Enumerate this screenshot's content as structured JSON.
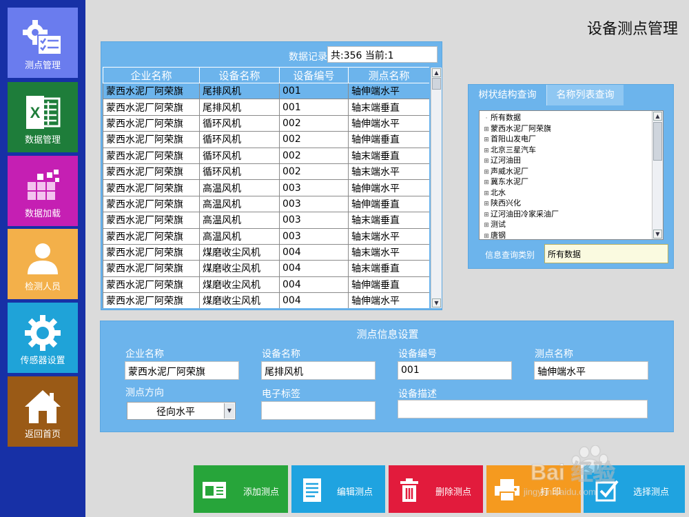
{
  "page_title": "设备测点管理",
  "sidebar": {
    "items": [
      {
        "label": "测点管理",
        "color": "#6a7cee",
        "icon": "gear-checklist-icon"
      },
      {
        "label": "数据管理",
        "color": "#1e7d3a",
        "icon": "excel-icon"
      },
      {
        "label": "数据加载",
        "color": "#c51fb3",
        "icon": "cubes-icon"
      },
      {
        "label": "检测人员",
        "color": "#f3b04a",
        "icon": "person-icon"
      },
      {
        "label": "传感器设置",
        "color": "#1fa3d8",
        "icon": "gear-icon"
      },
      {
        "label": "返回首页",
        "color": "#9a5a16",
        "icon": "home-icon"
      }
    ]
  },
  "records": {
    "label": "数据记录",
    "count": "共:356  当前:1",
    "columns": [
      "企业名称",
      "设备名称",
      "设备编号",
      "测点名称"
    ],
    "rows": [
      [
        "蒙西水泥厂阿荣旗",
        "尾排风机",
        "001",
        "轴伸端水平"
      ],
      [
        "蒙西水泥厂阿荣旗",
        "尾排风机",
        "001",
        "轴末端垂直"
      ],
      [
        "蒙西水泥厂阿荣旗",
        "循环风机",
        "002",
        "轴伸端水平"
      ],
      [
        "蒙西水泥厂阿荣旗",
        "循环风机",
        "002",
        "轴伸端垂直"
      ],
      [
        "蒙西水泥厂阿荣旗",
        "循环风机",
        "002",
        "轴末端垂直"
      ],
      [
        "蒙西水泥厂阿荣旗",
        "循环风机",
        "002",
        "轴末端水平"
      ],
      [
        "蒙西水泥厂阿荣旗",
        "高温风机",
        "003",
        "轴伸端水平"
      ],
      [
        "蒙西水泥厂阿荣旗",
        "高温风机",
        "003",
        "轴伸端垂直"
      ],
      [
        "蒙西水泥厂阿荣旗",
        "高温风机",
        "003",
        "轴末端垂直"
      ],
      [
        "蒙西水泥厂阿荣旗",
        "高温风机",
        "003",
        "轴末端水平"
      ],
      [
        "蒙西水泥厂阿荣旗",
        "煤磨收尘风机",
        "004",
        "轴末端水平"
      ],
      [
        "蒙西水泥厂阿荣旗",
        "煤磨收尘风机",
        "004",
        "轴末端垂直"
      ],
      [
        "蒙西水泥厂阿荣旗",
        "煤磨收尘风机",
        "004",
        "轴伸端垂直"
      ],
      [
        "蒙西水泥厂阿荣旗",
        "煤磨收尘风机",
        "004",
        "轴伸端水平"
      ]
    ]
  },
  "tree": {
    "tabs": [
      "树状结构查询",
      "名称列表查询"
    ],
    "items": [
      "所有数据",
      "蒙西水泥厂阿荣旗",
      "首阳山发电厂",
      "北京三星汽车",
      "辽河油田",
      "声威水泥厂",
      "冀东水泥厂",
      "北水",
      "陕西兴化",
      "辽河油田冷家采油厂",
      "测试",
      "唐钢"
    ],
    "query_label": "信息查询类别",
    "query_value": "所有数据"
  },
  "info": {
    "title": "测点信息设置",
    "company_label": "企业名称",
    "company_value": "蒙西水泥厂阿荣旗",
    "device_label": "设备名称",
    "device_value": "尾排风机",
    "code_label": "设备编号",
    "code_value": "001",
    "point_label": "测点名称",
    "point_value": "轴伸端水平",
    "direction_label": "测点方向",
    "direction_value": "径向水平",
    "tag_label": "电子标签",
    "tag_value": "",
    "desc_label": "设备描述",
    "desc_value": ""
  },
  "actions": [
    {
      "label": "添加测点",
      "color": "#27a53a",
      "icon": "add-card-icon"
    },
    {
      "label": "编辑测点",
      "color": "#1fa3e0",
      "icon": "document-icon"
    },
    {
      "label": "删除测点",
      "color": "#e21b3c",
      "icon": "trash-icon"
    },
    {
      "label": "打 印",
      "color": "#f59a1f",
      "icon": "printer-icon"
    },
    {
      "label": "选择测点",
      "color": "#1fa3e0",
      "icon": "checkbox-icon"
    }
  ],
  "watermark": {
    "text": "Bai  经验",
    "sub": "jingyan.baidu.com"
  }
}
